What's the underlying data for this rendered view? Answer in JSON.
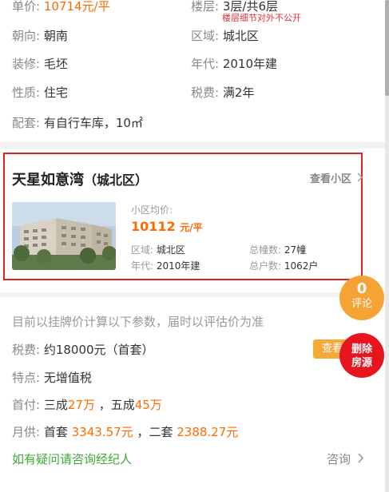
{
  "details": {
    "unit_price": {
      "label": "单价:",
      "value": "10714元/平"
    },
    "floor": {
      "label": "楼层:",
      "value": "3层/共6层",
      "note": "楼层细节对外不公开"
    },
    "orientation": {
      "label": "朝向:",
      "value": "朝南"
    },
    "district": {
      "label": "区域:",
      "value": "城北区"
    },
    "decoration": {
      "label": "装修:",
      "value": "毛坯"
    },
    "year": {
      "label": "年代:",
      "value": "2010年建"
    },
    "property_type": {
      "label": "性质:",
      "value": "住宅"
    },
    "tax": {
      "label": "税费:",
      "value": "满2年"
    },
    "facilities": {
      "label": "配套:",
      "value": "有自行车库，10㎡"
    }
  },
  "community": {
    "name": "天星如意湾",
    "area": "（城北区）",
    "view_link": "查看小区",
    "avg_label": "小区均价:",
    "avg_price": "10112",
    "avg_unit": "元/平",
    "district_label": "区域:",
    "district_value": "城北区",
    "buildings_label": "总幢数:",
    "buildings_value": "27幢",
    "year_label": "年代:",
    "year_value": "2010年建",
    "households_label": "总户数:",
    "households_value": "1062户"
  },
  "calculation": {
    "note": "目前以挂牌价计算以下参数，届时以评估价为准",
    "tax_label": "税费:",
    "tax_value": "约18000元（首套）",
    "view_button": "查看",
    "feature_label": "特点:",
    "feature_value": "无增值税",
    "down_label": "首付:",
    "down_30_prefix": "三成",
    "down_30_value": "27万",
    "down_50_prefix": "，五成",
    "down_50_value": "45万",
    "monthly_label": "月供:",
    "monthly_first_prefix": "首套",
    "monthly_first_value": "3343.57元",
    "monthly_second_prefix": "，二套",
    "monthly_second_value": "2388.27元",
    "consult_text": "如有疑问请咨询经纪人",
    "consult_button": "咨询"
  },
  "floating": {
    "comment_count": "0",
    "comment_label": "评论",
    "delete_line1": "删除",
    "delete_line2": "房源"
  },
  "colors": {
    "accent": "#ff6a00",
    "frame": "#e52222",
    "green": "#3ea83a",
    "comment": "#f5a335",
    "delete": "#e8141e"
  }
}
